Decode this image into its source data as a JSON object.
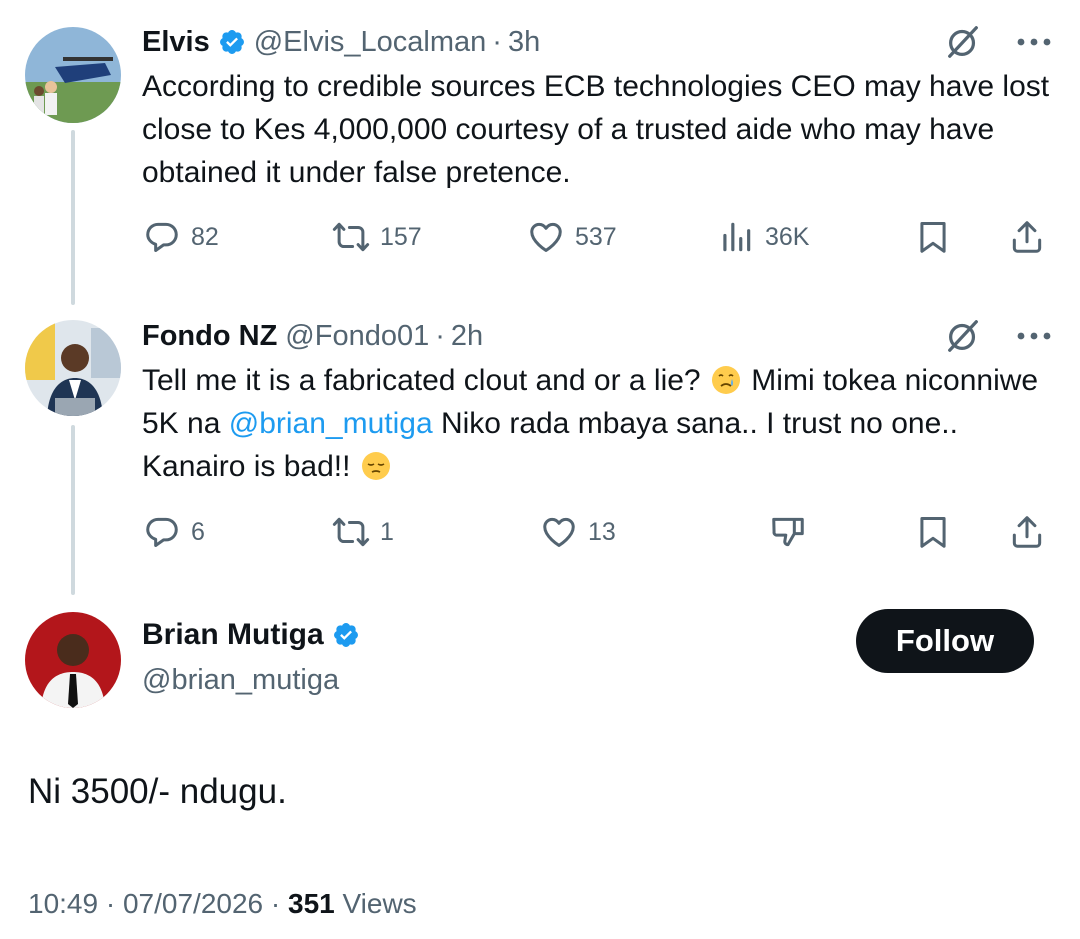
{
  "tweets": [
    {
      "name": "Elvis",
      "handle": "@Elvis_Localman",
      "time": "3h",
      "verified": true,
      "text": "According to credible sources ECB technologies CEO may have lost close to Kes 4,000,000 courtesy of a trusted aide who may have obtained it under false pretence.",
      "replies": "82",
      "reposts": "157",
      "likes": "537",
      "views": "36K"
    },
    {
      "name": "Fondo NZ",
      "handle": "@Fondo01",
      "time": "2h",
      "verified": false,
      "text_part1": "Tell me it is a fabricated clout and or a lie?",
      "text_part2": " Mimi tokea niconniwe 5K na ",
      "mention": "@brian_mutiga",
      "text_part3": " Niko rada mbaya sana.. I trust no one.. Kanairo is bad!! ",
      "replies": "6",
      "reposts": "1",
      "likes": "13"
    }
  ],
  "reply": {
    "name": "Brian Mutiga",
    "handle": "@brian_mutiga",
    "verified": true,
    "follow_label": "Follow",
    "text": "Ni 3500/- ndugu.",
    "time": "10:49",
    "date": "07/07/2026",
    "views_count": "351",
    "views_label": "Views"
  },
  "colors": {
    "text": "#0f1419",
    "secondary": "#536471",
    "link": "#1d9bf0",
    "verified": "#1d9bf0",
    "thread_line": "#cfd9de"
  }
}
